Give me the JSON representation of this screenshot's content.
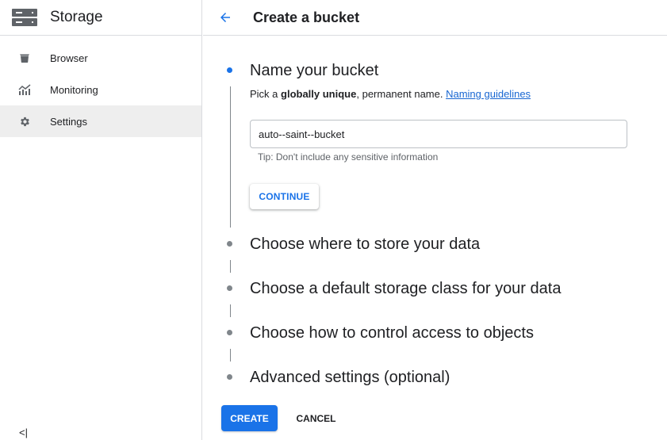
{
  "sidebar": {
    "title": "Storage",
    "product_icon": "storage-icon",
    "items": [
      {
        "label": "Browser",
        "icon": "bucket-icon"
      },
      {
        "label": "Monitoring",
        "icon": "chart-icon"
      },
      {
        "label": "Settings",
        "icon": "gear-icon",
        "active": true
      }
    ],
    "collapse_label": "<|"
  },
  "header": {
    "back_icon": "arrow-left-icon",
    "title": "Create a bucket"
  },
  "steps": [
    {
      "title": "Name your bucket",
      "active": true,
      "description": {
        "prefix": "Pick a ",
        "bold": "globally unique",
        "middle": ", permanent name. ",
        "link": "Naming guidelines"
      },
      "input_value": "auto--saint--bucket",
      "tip": "Tip: Don't include any sensitive information",
      "continue_label": "CONTINUE"
    },
    {
      "title": "Choose where to store your data"
    },
    {
      "title": "Choose a default storage class for your data"
    },
    {
      "title": "Choose how to control access to objects"
    },
    {
      "title": "Advanced settings (optional)"
    }
  ],
  "actions": {
    "create_label": "CREATE",
    "cancel_label": "CANCEL"
  },
  "colors": {
    "accent": "#1a73e8",
    "link": "#1967d2",
    "text": "#202124",
    "muted": "#5f6368",
    "active_bg": "#eeeeee"
  }
}
